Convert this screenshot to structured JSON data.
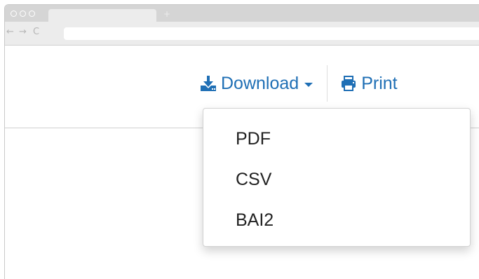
{
  "browser": {
    "new_tab_glyph": "+",
    "back_glyph": "←",
    "forward_glyph": "→",
    "reload_glyph": "C",
    "url": ""
  },
  "actions": {
    "download": {
      "label": "Download",
      "icon": "download-icon"
    },
    "print": {
      "label": "Print",
      "icon": "print-icon"
    }
  },
  "dropdown": {
    "items": [
      {
        "label": "PDF"
      },
      {
        "label": "CSV"
      },
      {
        "label": "BAI2"
      }
    ]
  },
  "colors": {
    "link": "#1f6fb5",
    "menu_text": "#222222",
    "chrome": "#d5d5d5",
    "toolbar": "#ececec"
  }
}
